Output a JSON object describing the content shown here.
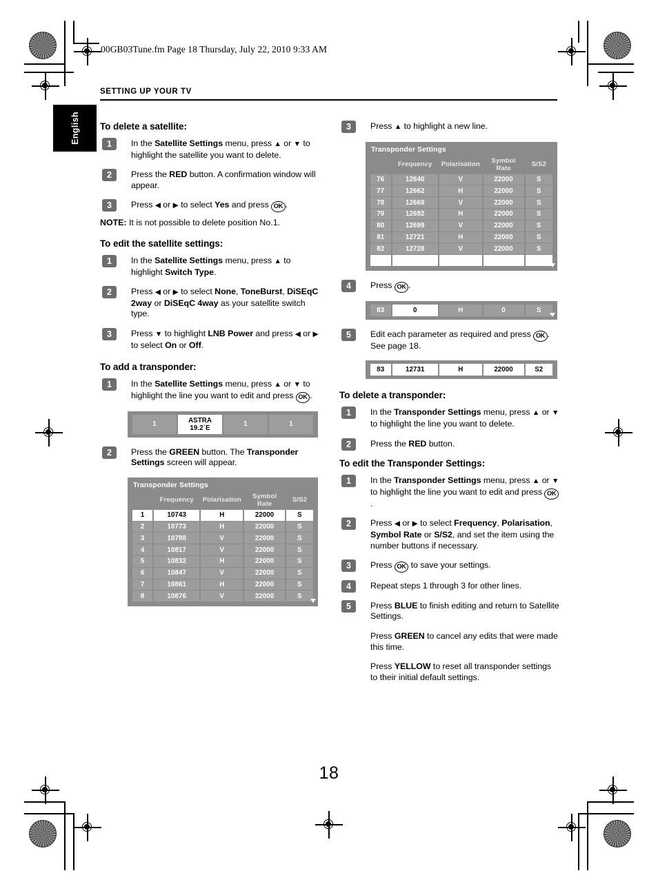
{
  "print": {
    "file_header": "00GB03Tune.fm  Page 18  Thursday, July 22, 2010  9:33 AM",
    "section": "SETTING UP YOUR TV",
    "language_tab": "English",
    "page_number": "18"
  },
  "left_column": {
    "section1": {
      "heading": "To delete a satellite:",
      "steps": [
        {
          "num": "1",
          "html": "In the <b>Satellite Settings</b> menu, press <span class=\"arw\">▲</span> or <span class=\"arw\">▼</span> to highlight the satellite you want to delete."
        },
        {
          "num": "2",
          "html": "Press the <b>RED</b> button. A confirmation window will appear."
        },
        {
          "num": "3",
          "html": "Press <span class=\"arw\">◀</span> or <span class=\"arw\">▶</span> to select <b>Yes</b> and press <span class=\"okbtn\">OK</span>."
        }
      ],
      "note": "<b>NOTE:</b> It is not possible to delete position No.1."
    },
    "section2": {
      "heading": "To edit the satellite settings:",
      "steps": [
        {
          "num": "1",
          "html": "In the <b>Satellite Settings</b> menu, press <span class=\"arw\">▲</span> to highlight <b>Switch Type</b>."
        },
        {
          "num": "2",
          "html": "Press <span class=\"arw\">◀</span> or <span class=\"arw\">▶</span> to select <b>None</b>, <b>ToneBurst</b>, <b>DiSEqC 2way</b> or <b>DiSEqC 4way</b> as your satellite switch type."
        },
        {
          "num": "3",
          "html": "Press <span class=\"arw\">▼</span> to highlight <b>LNB Power</b> and press <span class=\"arw\">◀</span> or <span class=\"arw\">▶</span> to select <b>On</b> or <b>Off</b>."
        }
      ]
    },
    "section3": {
      "heading": "To add a transponder:",
      "steps": [
        {
          "num": "1",
          "html": "In the <b>Satellite Settings</b> menu, press <span class=\"arw\">▲</span> or <span class=\"arw\">▼</span> to highlight the line you want to edit and press <span class=\"okbtn\">OK</span>."
        },
        {
          "num": "2",
          "html": "Press the <b>GREEN</b> button. The <b>Transponder Settings</b> screen will appear."
        }
      ]
    },
    "satellite_strip": {
      "cells": [
        "1",
        "ASTRA 19.2˙E",
        "1",
        "1"
      ],
      "selected_index": 1
    },
    "transponder_table": {
      "title": "Transponder Settings",
      "columns": [
        "",
        "Frequency",
        "Polarisation",
        "Symbol Rate",
        "S/S2"
      ],
      "rows": [
        {
          "index": "1",
          "frequency": "10743",
          "polarisation": "H",
          "symbol_rate": "22000",
          "ss2": "S",
          "selected": true
        },
        {
          "index": "2",
          "frequency": "10773",
          "polarisation": "H",
          "symbol_rate": "22000",
          "ss2": "S",
          "selected": false
        },
        {
          "index": "3",
          "frequency": "10788",
          "polarisation": "V",
          "symbol_rate": "22000",
          "ss2": "S",
          "selected": false
        },
        {
          "index": "4",
          "frequency": "10817",
          "polarisation": "V",
          "symbol_rate": "22000",
          "ss2": "S",
          "selected": false
        },
        {
          "index": "5",
          "frequency": "10832",
          "polarisation": "H",
          "symbol_rate": "22000",
          "ss2": "S",
          "selected": false
        },
        {
          "index": "6",
          "frequency": "10847",
          "polarisation": "V",
          "symbol_rate": "22000",
          "ss2": "S",
          "selected": false
        },
        {
          "index": "7",
          "frequency": "10861",
          "polarisation": "H",
          "symbol_rate": "22000",
          "ss2": "S",
          "selected": false
        },
        {
          "index": "8",
          "frequency": "10876",
          "polarisation": "V",
          "symbol_rate": "22000",
          "ss2": "S",
          "selected": false
        }
      ]
    }
  },
  "right_column": {
    "step3": {
      "num": "3",
      "html": "Press <span class=\"arw\">▲</span> to highlight a new line."
    },
    "transponder_table": {
      "title": "Transponder Settings",
      "columns": [
        "",
        "Frequency",
        "Polarisation",
        "Symbol Rate",
        "S/S2"
      ],
      "rows": [
        {
          "index": "76",
          "frequency": "12640",
          "polarisation": "V",
          "symbol_rate": "22000",
          "ss2": "S",
          "selected": false
        },
        {
          "index": "77",
          "frequency": "12662",
          "polarisation": "H",
          "symbol_rate": "22000",
          "ss2": "S",
          "selected": false
        },
        {
          "index": "78",
          "frequency": "12669",
          "polarisation": "V",
          "symbol_rate": "22000",
          "ss2": "S",
          "selected": false
        },
        {
          "index": "79",
          "frequency": "12692",
          "polarisation": "H",
          "symbol_rate": "22000",
          "ss2": "S",
          "selected": false
        },
        {
          "index": "80",
          "frequency": "12699",
          "polarisation": "V",
          "symbol_rate": "22000",
          "ss2": "S",
          "selected": false
        },
        {
          "index": "81",
          "frequency": "12721",
          "polarisation": "H",
          "symbol_rate": "22000",
          "ss2": "S",
          "selected": false
        },
        {
          "index": "82",
          "frequency": "12728",
          "polarisation": "V",
          "symbol_rate": "22000",
          "ss2": "S",
          "selected": false
        },
        {
          "index": "83",
          "frequency": "",
          "polarisation": "",
          "symbol_rate": "",
          "ss2": "",
          "selected": true
        }
      ]
    },
    "step4": {
      "num": "4",
      "html": "Press <span class=\"okbtn\">OK</span>."
    },
    "strip_edit": {
      "cells": [
        "83",
        "0",
        "H",
        "0",
        "S"
      ],
      "selected_index": 1
    },
    "step5": {
      "num": "5",
      "html": "Edit each parameter as required and press <span class=\"okbtn\">OK</span>. See page 18."
    },
    "strip_done": {
      "cells": [
        "83",
        "12731",
        "H",
        "22000",
        "S2"
      ],
      "all_selected": true
    },
    "section_delete": {
      "heading": "To delete a transponder:",
      "steps": [
        {
          "num": "1",
          "html": "In the <b>Transponder Settings</b> menu, press <span class=\"arw\">▲</span> or <span class=\"arw\">▼</span> to highlight the line you want to delete."
        },
        {
          "num": "2",
          "html": "Press the <b>RED</b> button."
        }
      ]
    },
    "section_edit": {
      "heading": "To edit the Transponder Settings:",
      "steps": [
        {
          "num": "1",
          "html": "In the <b>Transponder Settings</b> menu, press <span class=\"arw\">▲</span> or <span class=\"arw\">▼</span> to highlight the line you want to edit and press <span class=\"okbtn\">OK</span>."
        },
        {
          "num": "2",
          "html": "Press <span class=\"arw\">◀</span> or <span class=\"arw\">▶</span> to select <b>Frequency</b>, <b>Polarisation</b>, <b>Symbol Rate</b> or <b>S/S2</b>, and set the item using the number buttons if necessary."
        },
        {
          "num": "3",
          "html": "Press <span class=\"okbtn\">OK</span> to save your settings."
        },
        {
          "num": "4",
          "html": "Repeat steps 1 through 3 for other lines."
        },
        {
          "num": "5",
          "html": "Press <b>BLUE</b> to finish editing and return to Satellite Settings."
        }
      ],
      "extra_paragraphs": [
        "Press <b>GREEN</b> to cancel any edits that were made this time.",
        "Press <b>YELLOW</b> to reset all transponder settings to their initial default settings."
      ]
    }
  },
  "colors": {
    "osd_background": "#8b8b8b",
    "osd_row": "#9d9d9d",
    "osd_selected": "#ffffff",
    "step_badge": "#6d6d6d",
    "tab_background": "#000000"
  }
}
